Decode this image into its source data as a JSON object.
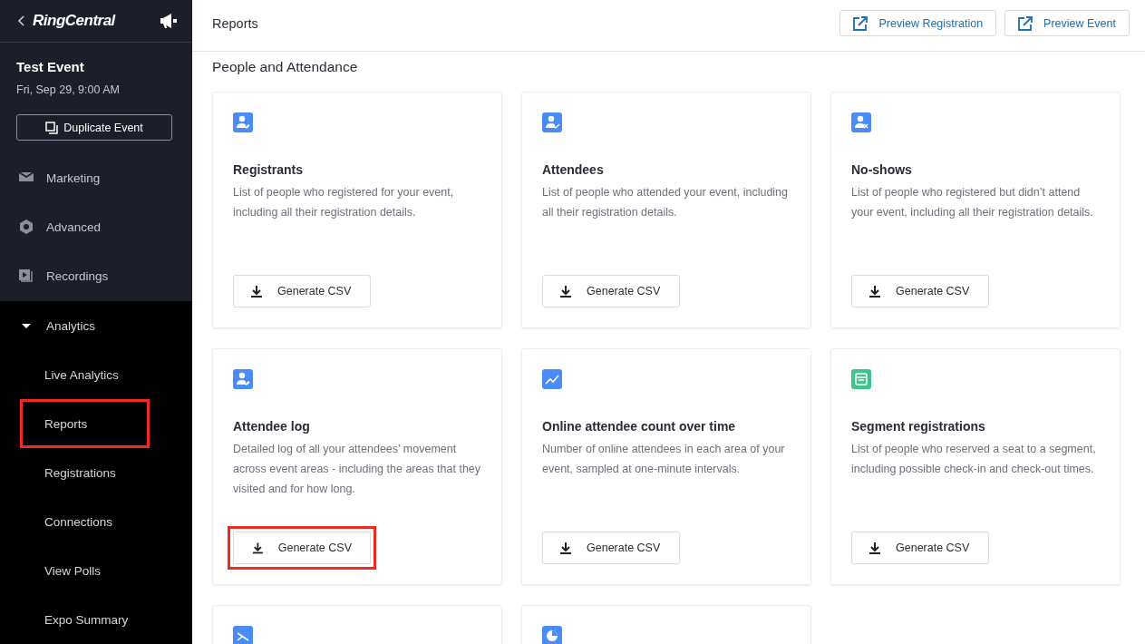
{
  "sidebar": {
    "brand": "RingCentral",
    "event_title": "Test Event",
    "event_date": "Fri, Sep 29, 9:00 AM",
    "duplicate_button": "Duplicate Event",
    "items": [
      {
        "label": "Marketing",
        "kind": "mail",
        "highlighted": false
      },
      {
        "label": "Advanced",
        "kind": "settings",
        "highlighted": false
      },
      {
        "label": "Recordings",
        "kind": "video",
        "highlighted": false
      },
      {
        "label": "Analytics",
        "kind": "group",
        "expanded": true,
        "children": [
          {
            "label": "Live Analytics",
            "highlighted": false
          },
          {
            "label": "Reports",
            "highlighted": true
          },
          {
            "label": "Registrations",
            "highlighted": false
          },
          {
            "label": "Connections",
            "highlighted": false
          },
          {
            "label": "View Polls",
            "highlighted": false
          },
          {
            "label": "Expo Summary",
            "highlighted": false
          }
        ]
      }
    ]
  },
  "header": {
    "title": "Reports",
    "buttons": [
      "Preview Registration",
      "Preview Event"
    ]
  },
  "section_title": "People and Attendance",
  "cards": [
    {
      "kind": "registrants",
      "color": "#4a8cf7",
      "title": "Registrants",
      "description": "List of people who registered for your event, including all their registration details.",
      "button": "Generate CSV",
      "highlighted": false
    },
    {
      "kind": "attendees",
      "color": "#4a8cf7",
      "title": "Attendees",
      "description": "List of people who attended your event, including all their registration details.",
      "button": "Generate CSV",
      "highlighted": false
    },
    {
      "kind": "noshows",
      "color": "#4a8cf7",
      "title": "No-shows",
      "description": "List of people who registered but didn’t attend your event, including all their registration details.",
      "button": "Generate CSV",
      "highlighted": false
    },
    {
      "kind": "registrants",
      "color": "#4a8cf7",
      "title": "Attendee log",
      "description": "Detailed log of all your attendees’ movement across event areas - including the areas that they visited and for how long.",
      "button": "Generate CSV",
      "highlighted": true
    },
    {
      "kind": "trend",
      "color": "#4a8cf7",
      "title": "Online attendee count over time",
      "description": "Number of online attendees in each area of your event, sampled at one-minute intervals.",
      "button": "Generate CSV",
      "highlighted": false
    },
    {
      "kind": "calendar",
      "color": "#3ec58a",
      "title": "Segment registrations",
      "description": "List of people who reserved a seat to a segment, including possible check-in and check-out times.",
      "button": "Generate CSV",
      "highlighted": false
    },
    {
      "kind": "lines",
      "color": "#4a8cf7"
    },
    {
      "kind": "pie",
      "color": "#4a8cf7"
    }
  ]
}
